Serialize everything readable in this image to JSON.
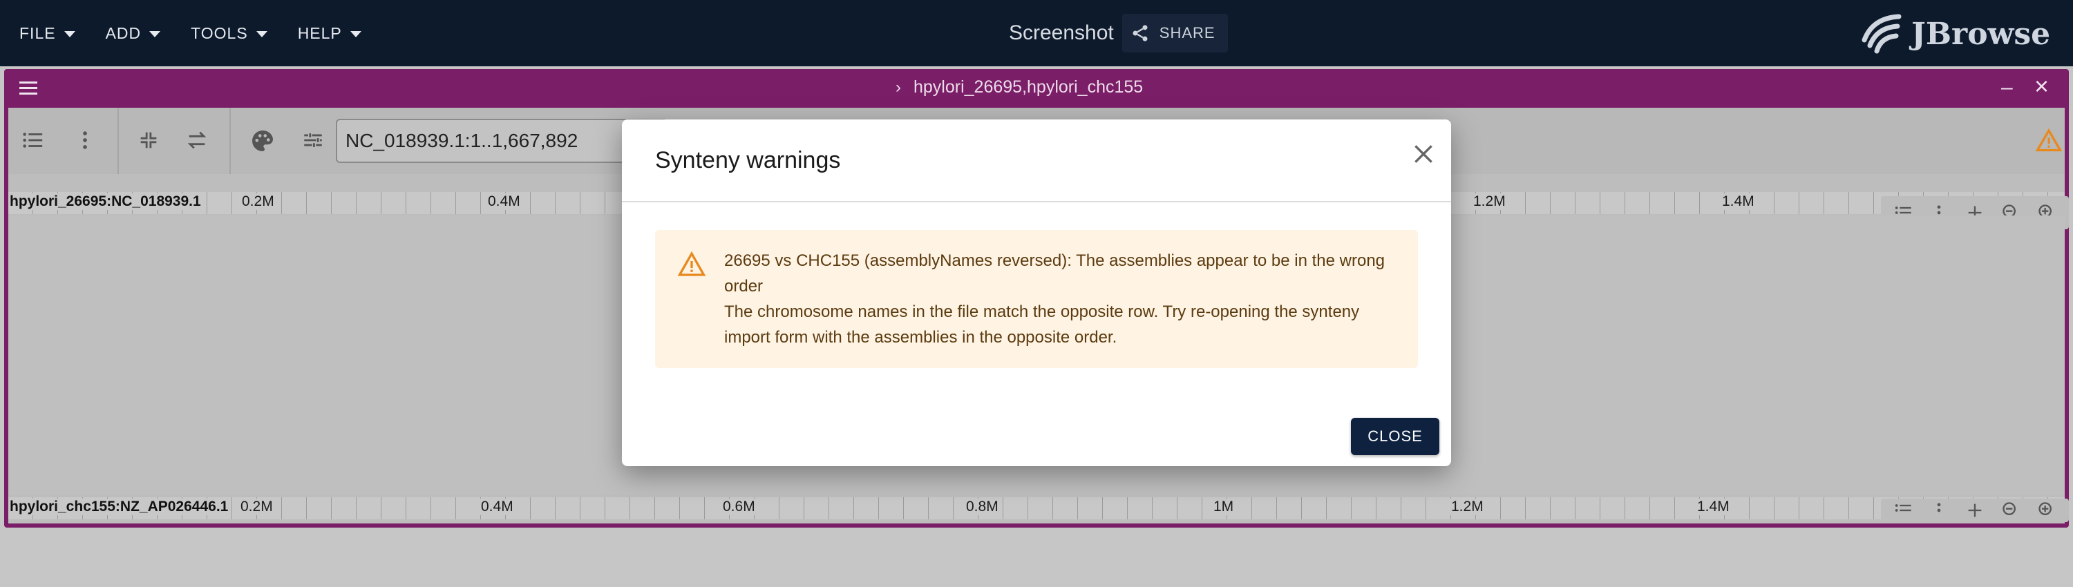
{
  "appbar": {
    "menus": [
      {
        "label": "FILE"
      },
      {
        "label": "ADD"
      },
      {
        "label": "TOOLS"
      },
      {
        "label": "HELP"
      }
    ],
    "title": "Screenshot",
    "share_label": "SHARE",
    "logo_text": "JBrowse"
  },
  "view": {
    "name": "hpylori_26695,hpylori_chc155",
    "locstring": "NC_018939.1:1..1,667,892",
    "top_ruler": {
      "name": "hpylori_26695:NC_018939.1",
      "ticks": [
        "0.2M",
        "0.4M",
        "1.2M",
        "1.4M"
      ]
    },
    "bottom_ruler": {
      "name": "hpylori_chc155:NZ_AP026446.1",
      "ticks": [
        "0.2M",
        "0.4M",
        "0.6M",
        "0.8M",
        "1M",
        "1.2M",
        "1.4M"
      ]
    }
  },
  "modal": {
    "title": "Synteny warnings",
    "message_line1": "26695 vs CHC155 (assemblyNames reversed): The assemblies appear to be in the wrong order",
    "message_line2": "The chromosome names in the file match the opposite row. Try re-opening the synteny import form with the assemblies in the opposite order.",
    "close_label": "CLOSE"
  },
  "colors": {
    "appbar_bg": "#0d1a2c",
    "view_header": "#7a1e68",
    "alert_bg": "#fff3e3",
    "warning": "#e8891e",
    "close_button": "#0e213f"
  }
}
